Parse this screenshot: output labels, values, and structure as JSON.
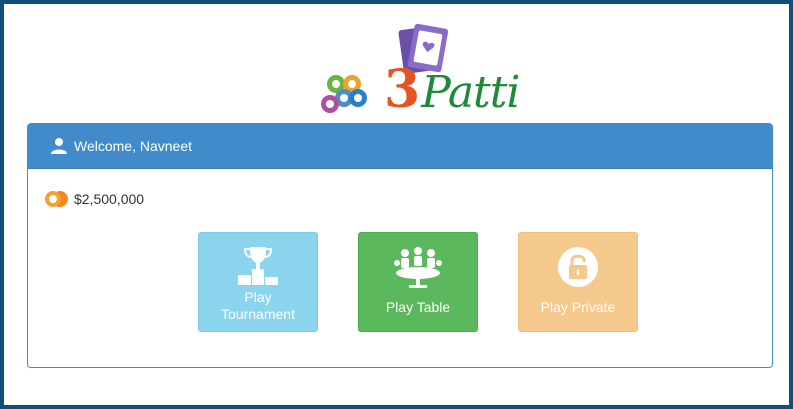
{
  "colors": {
    "frame": "#0f4f7a",
    "panel_header": "#428bca",
    "tournament": "#8ad4ee",
    "table": "#5cb85c",
    "private": "#f5c98c",
    "logo_text": "#1e8a3a",
    "logo_three": "#e8541f"
  },
  "logo": {
    "number": "3",
    "word": "Patti",
    "icons": [
      "playing-card-icon",
      "poker-chip-icon"
    ]
  },
  "panel": {
    "icon": "user-icon",
    "welcome": "Welcome, Navneet"
  },
  "balance": {
    "icon": "coin-icon",
    "amount": "$2,500,000"
  },
  "tiles": [
    {
      "id": "tournament",
      "icon": "trophy-podium-icon",
      "label_line1": "Play",
      "label_line2": "Tournament"
    },
    {
      "id": "table",
      "icon": "players-table-icon",
      "label": "Play Table"
    },
    {
      "id": "private",
      "icon": "padlock-icon",
      "label": "Play Private"
    }
  ]
}
